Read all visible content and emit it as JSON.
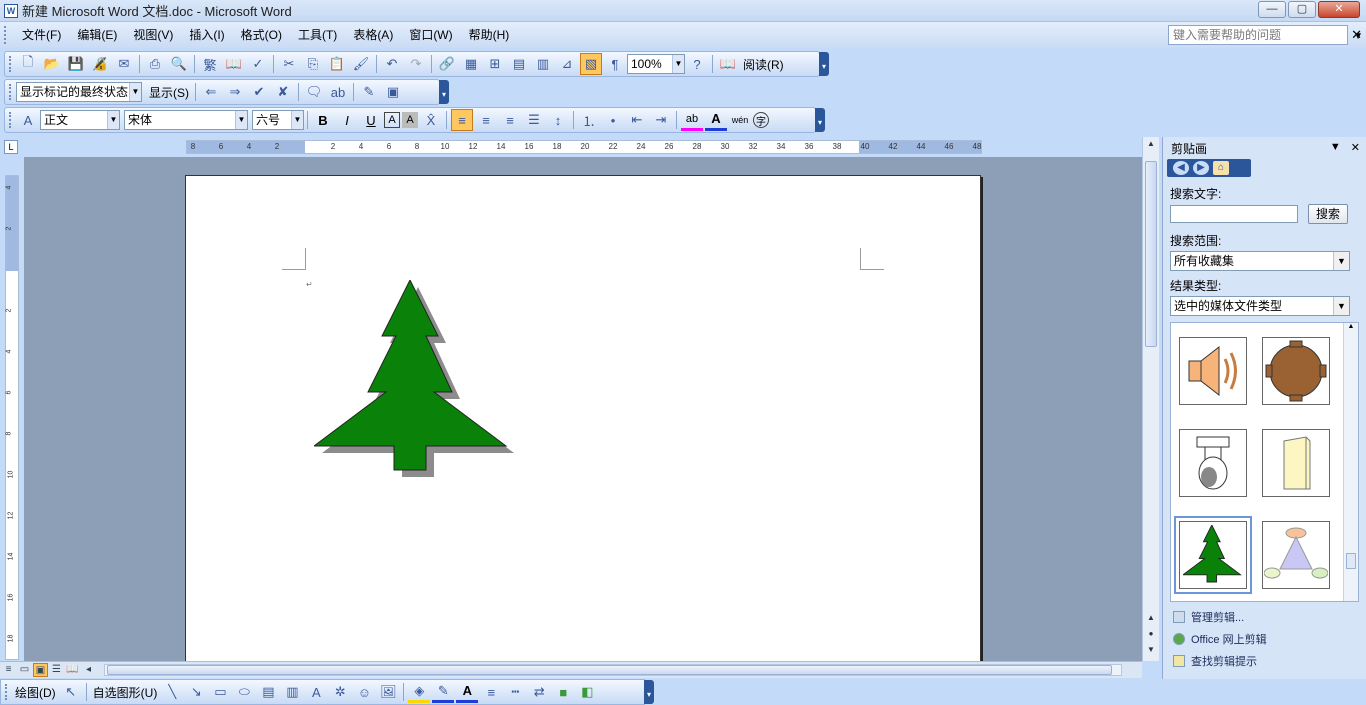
{
  "title_bar": {
    "app_icon": "W",
    "title": "新建 Microsoft Word 文档.doc - Microsoft Word",
    "buttons": {
      "minimize": "—",
      "maximize": "▢",
      "close": "✕"
    }
  },
  "menu": {
    "items": [
      "文件(F)",
      "编辑(E)",
      "视图(V)",
      "插入(I)",
      "格式(O)",
      "工具(T)",
      "表格(A)",
      "窗口(W)",
      "帮助(H)"
    ],
    "help_placeholder": "键入需要帮助的问题",
    "close_icon": "✕"
  },
  "standard_toolbar": {
    "zoom": "100%",
    "read_label": "阅读(R)",
    "icons": [
      "new-icon",
      "open-icon",
      "save-icon",
      "permission-icon",
      "email-icon",
      "print-icon",
      "print-preview-icon",
      "traditional-chinese-icon",
      "research-icon",
      "spelling-icon",
      "cut-icon",
      "copy-icon",
      "paste-icon",
      "format-painter-icon",
      "undo-icon",
      "redo-icon",
      "hyperlink-icon",
      "tables-borders-icon",
      "insert-table-icon",
      "insert-excel-icon",
      "columns-icon",
      "drawing-icon",
      "document-map-icon",
      "show-hide-icon",
      "help-icon"
    ]
  },
  "review_toolbar": {
    "display_mode": "显示标记的最终状态",
    "show_label": "显示(S)"
  },
  "format_toolbar": {
    "style": "正文",
    "font": "宋体",
    "size": "六号",
    "bold": "B",
    "italic": "I",
    "underline": "U",
    "char_border": "A",
    "char_shading": "A",
    "highlight": "ab",
    "font_color": "A",
    "phonetic": "wén",
    "enclose": "字"
  },
  "rulers": {
    "corner_symbol": "L",
    "horizontal_ticks": [
      "8",
      "6",
      "4",
      "2",
      "",
      "2",
      "4",
      "6",
      "8",
      "10",
      "12",
      "14",
      "16",
      "18",
      "20",
      "22",
      "24",
      "26",
      "28",
      "30",
      "32",
      "34",
      "36",
      "38",
      "40",
      "42",
      "44",
      "46",
      "48"
    ],
    "vertical_ticks": [
      "4",
      "2",
      "",
      "2",
      "4",
      "6",
      "8",
      "10",
      "12",
      "14",
      "16",
      "18"
    ]
  },
  "document": {
    "paragraph_mark": "↵",
    "shape": "tree",
    "shape_color": "#0a820a",
    "shadow_color": "#8c8c8c"
  },
  "drawing_toolbar": {
    "draw_label": "绘图(D)",
    "autoshapes_label": "自选图形(U)"
  },
  "task_pane": {
    "title": "剪贴画",
    "search_text_label": "搜索文字:",
    "search_button": "搜索",
    "search_in_label": "搜索范围:",
    "search_in_value": "所有收藏集",
    "result_types_label": "结果类型:",
    "result_types_value": "选中的媒体文件类型",
    "clips": [
      "speaker-icon",
      "brown-table-icon",
      "lamp-icon",
      "server-icon",
      "tree-icon",
      "diagram-icon"
    ],
    "links": [
      "管理剪辑...",
      "Office 网上剪辑",
      "查找剪辑提示"
    ]
  },
  "colors": {
    "accent": "#2b579a",
    "active_button": "#ffc75f",
    "doc_background": "#8d9eb7"
  }
}
